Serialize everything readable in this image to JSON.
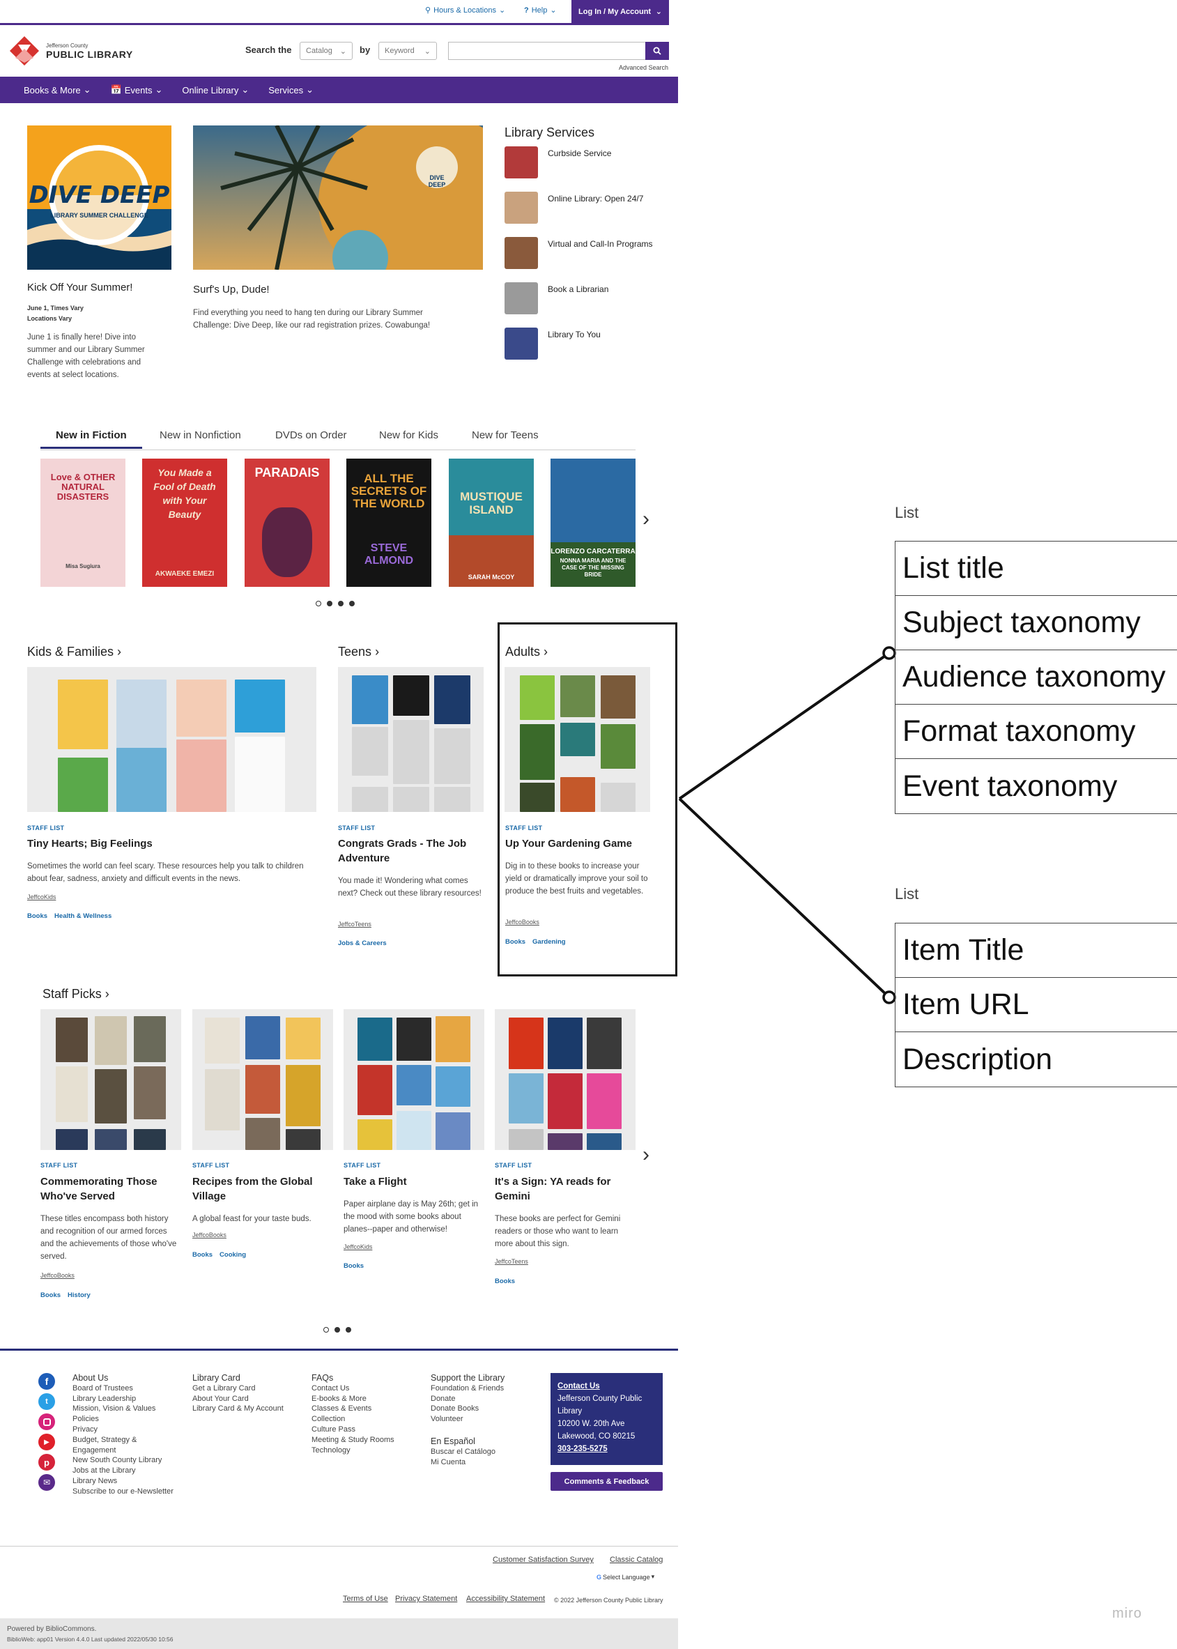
{
  "topbar": {
    "hours": "Hours & Locations",
    "help": "Help",
    "login": "Log In / My Account"
  },
  "header": {
    "org_small": "Jefferson County",
    "org_big": "PUBLIC LIBRARY",
    "search_the": "Search the",
    "catalog": "Catalog",
    "by": "by",
    "keyword": "Keyword",
    "advanced": "Advanced Search"
  },
  "nav": [
    "Books & More",
    "Events",
    "Online Library",
    "Services"
  ],
  "hero": {
    "card1": {
      "title": "Kick Off Your Summer!",
      "date": "June 1, Times Vary",
      "location": "Locations Vary",
      "text": "June 1 is finally here! Dive into summer and our Library Summer Challenge with celebrations and events at select locations.",
      "art_line1": "DIVE DEEP",
      "art_line2": "LIBRARY SUMMER CHALLENGE"
    },
    "card2": {
      "title": "Surf's Up, Dude!",
      "text": "Find everything you need to hang ten during our Library Summer Challenge: Dive Deep, like our rad registration prizes. Cowabunga!",
      "sticker": "DIVE DEEP"
    }
  },
  "services": {
    "title": "Library Services",
    "items": [
      {
        "label": "Curbside Service",
        "color": "#b23a3a"
      },
      {
        "label": "Online Library: Open 24/7",
        "color": "#c9a27e"
      },
      {
        "label": "Virtual and Call-In Programs",
        "color": "#8a5a3c"
      },
      {
        "label": "Book a Librarian",
        "color": "#9a9a9a"
      },
      {
        "label": "Library To You",
        "color": "#3a4a8a"
      }
    ]
  },
  "tabs": [
    "New in Fiction",
    "New in Nonfiction",
    "DVDs on Order",
    "New for Kids",
    "New for Teens"
  ],
  "books": [
    {
      "title": "Love & OTHER NATURAL DISASTERS",
      "author": "Misa Sugiura",
      "bg": "#f3d4d6",
      "fg": "#b3273c"
    },
    {
      "title": "You Made a Fool of Death with Your Beauty",
      "author": "AKWAEKE EMEZI",
      "bg": "#cf2f2f",
      "fg": "#f5e7d0"
    },
    {
      "title": "PARADAIS",
      "author": "",
      "bg": "#d13a3a",
      "fg": "#ffffff"
    },
    {
      "title": "ALL THE SECRETS OF THE WORLD",
      "author": "STEVE ALMOND",
      "bg": "#141414",
      "fg": "#e8a33a"
    },
    {
      "title": "MUSTIQUE ISLAND",
      "author": "SARAH McCOY",
      "bg": "#2a8c9b",
      "fg": "#f3e2b3"
    },
    {
      "title": "NONNA MARIA AND THE CASE OF THE MISSING BRIDE",
      "author": "LORENZO CARCATERRA",
      "bg": "#2b6aa3",
      "fg": "#ffffff"
    }
  ],
  "sections": {
    "kids": "Kids & Families",
    "teens": "Teens",
    "adults": "Adults",
    "staff_picks": "Staff Picks"
  },
  "lists": [
    {
      "kind": "STAFF LIST",
      "title": "Tiny Hearts; Big Feelings",
      "desc": "Sometimes the world can feel scary. These resources help you talk to children about fear, sadness, anxiety and difficult events in the news.",
      "author": "JeffcoKids",
      "tags": [
        "Books",
        "Health & Wellness"
      ]
    },
    {
      "kind": "STAFF LIST",
      "title": "Congrats Grads - The Job Adventure",
      "desc": "You made it! Wondering what comes next? Check out these library resources!",
      "author": "JeffcoTeens",
      "tags": [
        "Jobs & Careers"
      ]
    },
    {
      "kind": "STAFF LIST",
      "title": "Up Your Gardening Game",
      "desc": "Dig in to these books to increase your yield or dramatically improve your soil to produce the best fruits and vegetables.",
      "author": "JeffcoBooks",
      "tags": [
        "Books",
        "Gardening"
      ]
    }
  ],
  "staff_lists": [
    {
      "kind": "STAFF LIST",
      "title": "Commemorating Those Who've Served",
      "desc": "These titles encompass both history and recognition of our armed forces and the achievements of those who've served.",
      "author": "JeffcoBooks",
      "tags": [
        "Books",
        "History"
      ]
    },
    {
      "kind": "STAFF LIST",
      "title": "Recipes from the Global Village",
      "desc": "A global feast for your taste buds.",
      "author": "JeffcoBooks",
      "tags": [
        "Books",
        "Cooking"
      ]
    },
    {
      "kind": "STAFF LIST",
      "title": "Take a Flight",
      "desc": "Paper airplane day is May 26th; get in the mood with some books about planes--paper and otherwise!",
      "author": "JeffcoKids",
      "tags": [
        "Books"
      ]
    },
    {
      "kind": "STAFF LIST",
      "title": "It's a Sign: YA reads for Gemini",
      "desc": "These books are perfect for Gemini readers or those who want to learn more about this sign.",
      "author": "JeffcoTeens",
      "tags": [
        "Books"
      ]
    }
  ],
  "footer": {
    "col1": [
      "About Us",
      "Board of Trustees",
      "Library Leadership",
      "Mission, Vision & Values",
      "Policies",
      "Privacy",
      "Budget, Strategy &",
      "Engagement",
      "New South County Library",
      "Jobs at the Library",
      "Library News",
      "Subscribe to our e-Newsletter"
    ],
    "col2": [
      "Library Card",
      "Get a Library Card",
      "About Your Card",
      "Library Card & My Account"
    ],
    "col3": [
      "FAQs",
      "Contact Us",
      "E-books & More",
      "Classes & Events",
      "Collection",
      "Culture Pass",
      "Meeting & Study Rooms",
      "Technology"
    ],
    "col4": [
      "Support the Library",
      "Foundation & Friends",
      "Donate",
      "Donate Books",
      "Volunteer"
    ],
    "col4b": [
      "En Español",
      "Buscar el Catálogo",
      "Mi Cuenta"
    ],
    "contact": {
      "head": "Contact Us",
      "lines": [
        "Jefferson County Public Library",
        "10200 W. 20th Ave",
        "Lakewood, CO 80215"
      ],
      "phone": "303-235-5275"
    },
    "feedback": "Comments & Feedback",
    "survey": "Customer Satisfaction Survey",
    "classic": "Classic Catalog",
    "language": "Select Language",
    "terms": "Terms of Use",
    "privacy": "Privacy Statement",
    "accessibility": "Accessibility Statement",
    "copyright": "© 2022 Jefferson County Public Library",
    "powered": "Powered by BiblioCommons.",
    "version": "BiblioWeb: app01 Version 4.4.0 Last updated 2022/05/30 10:56"
  },
  "annotations": {
    "list1_label": "List",
    "list1_rows": [
      "List title",
      "Subject taxonomy",
      "Audience taxonomy",
      "Format taxonomy",
      "Event taxonomy"
    ],
    "list2_label": "List",
    "list2_rows": [
      "Item Title",
      "Item URL",
      "Description"
    ],
    "watermark": "miro"
  }
}
